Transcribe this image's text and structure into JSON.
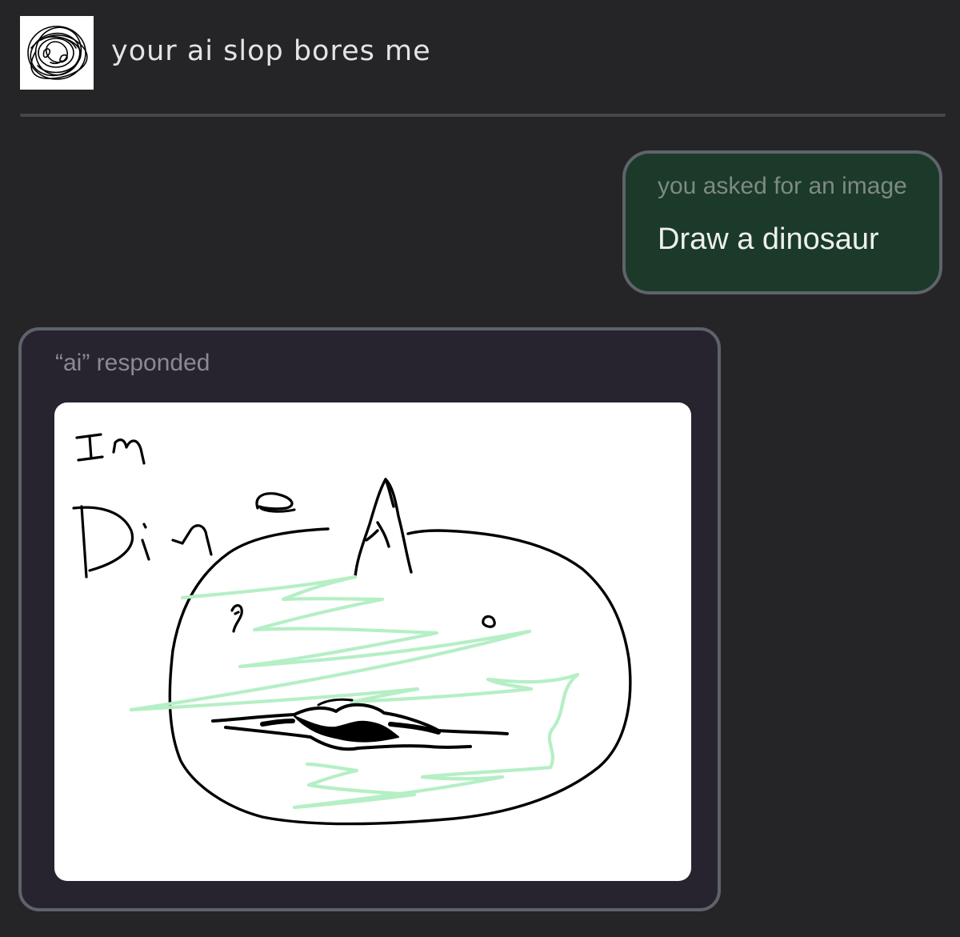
{
  "header": {
    "title": "your ai slop bores me",
    "avatar_icon": "scribble-avatar-icon"
  },
  "user_message": {
    "caption": "you asked for an image",
    "text": "Draw a dinosaur"
  },
  "ai_message": {
    "caption": "“ai” responded",
    "drawing": {
      "handwritten_text_line1": "Im",
      "handwritten_text_line2": "Dino",
      "scribble_color": "#b5efc5",
      "ink_color": "#000000"
    }
  },
  "colors": {
    "background": "#252527",
    "user_bubble": "#1b3a29",
    "ai_bubble": "#27242f",
    "border": "#5f636a"
  }
}
